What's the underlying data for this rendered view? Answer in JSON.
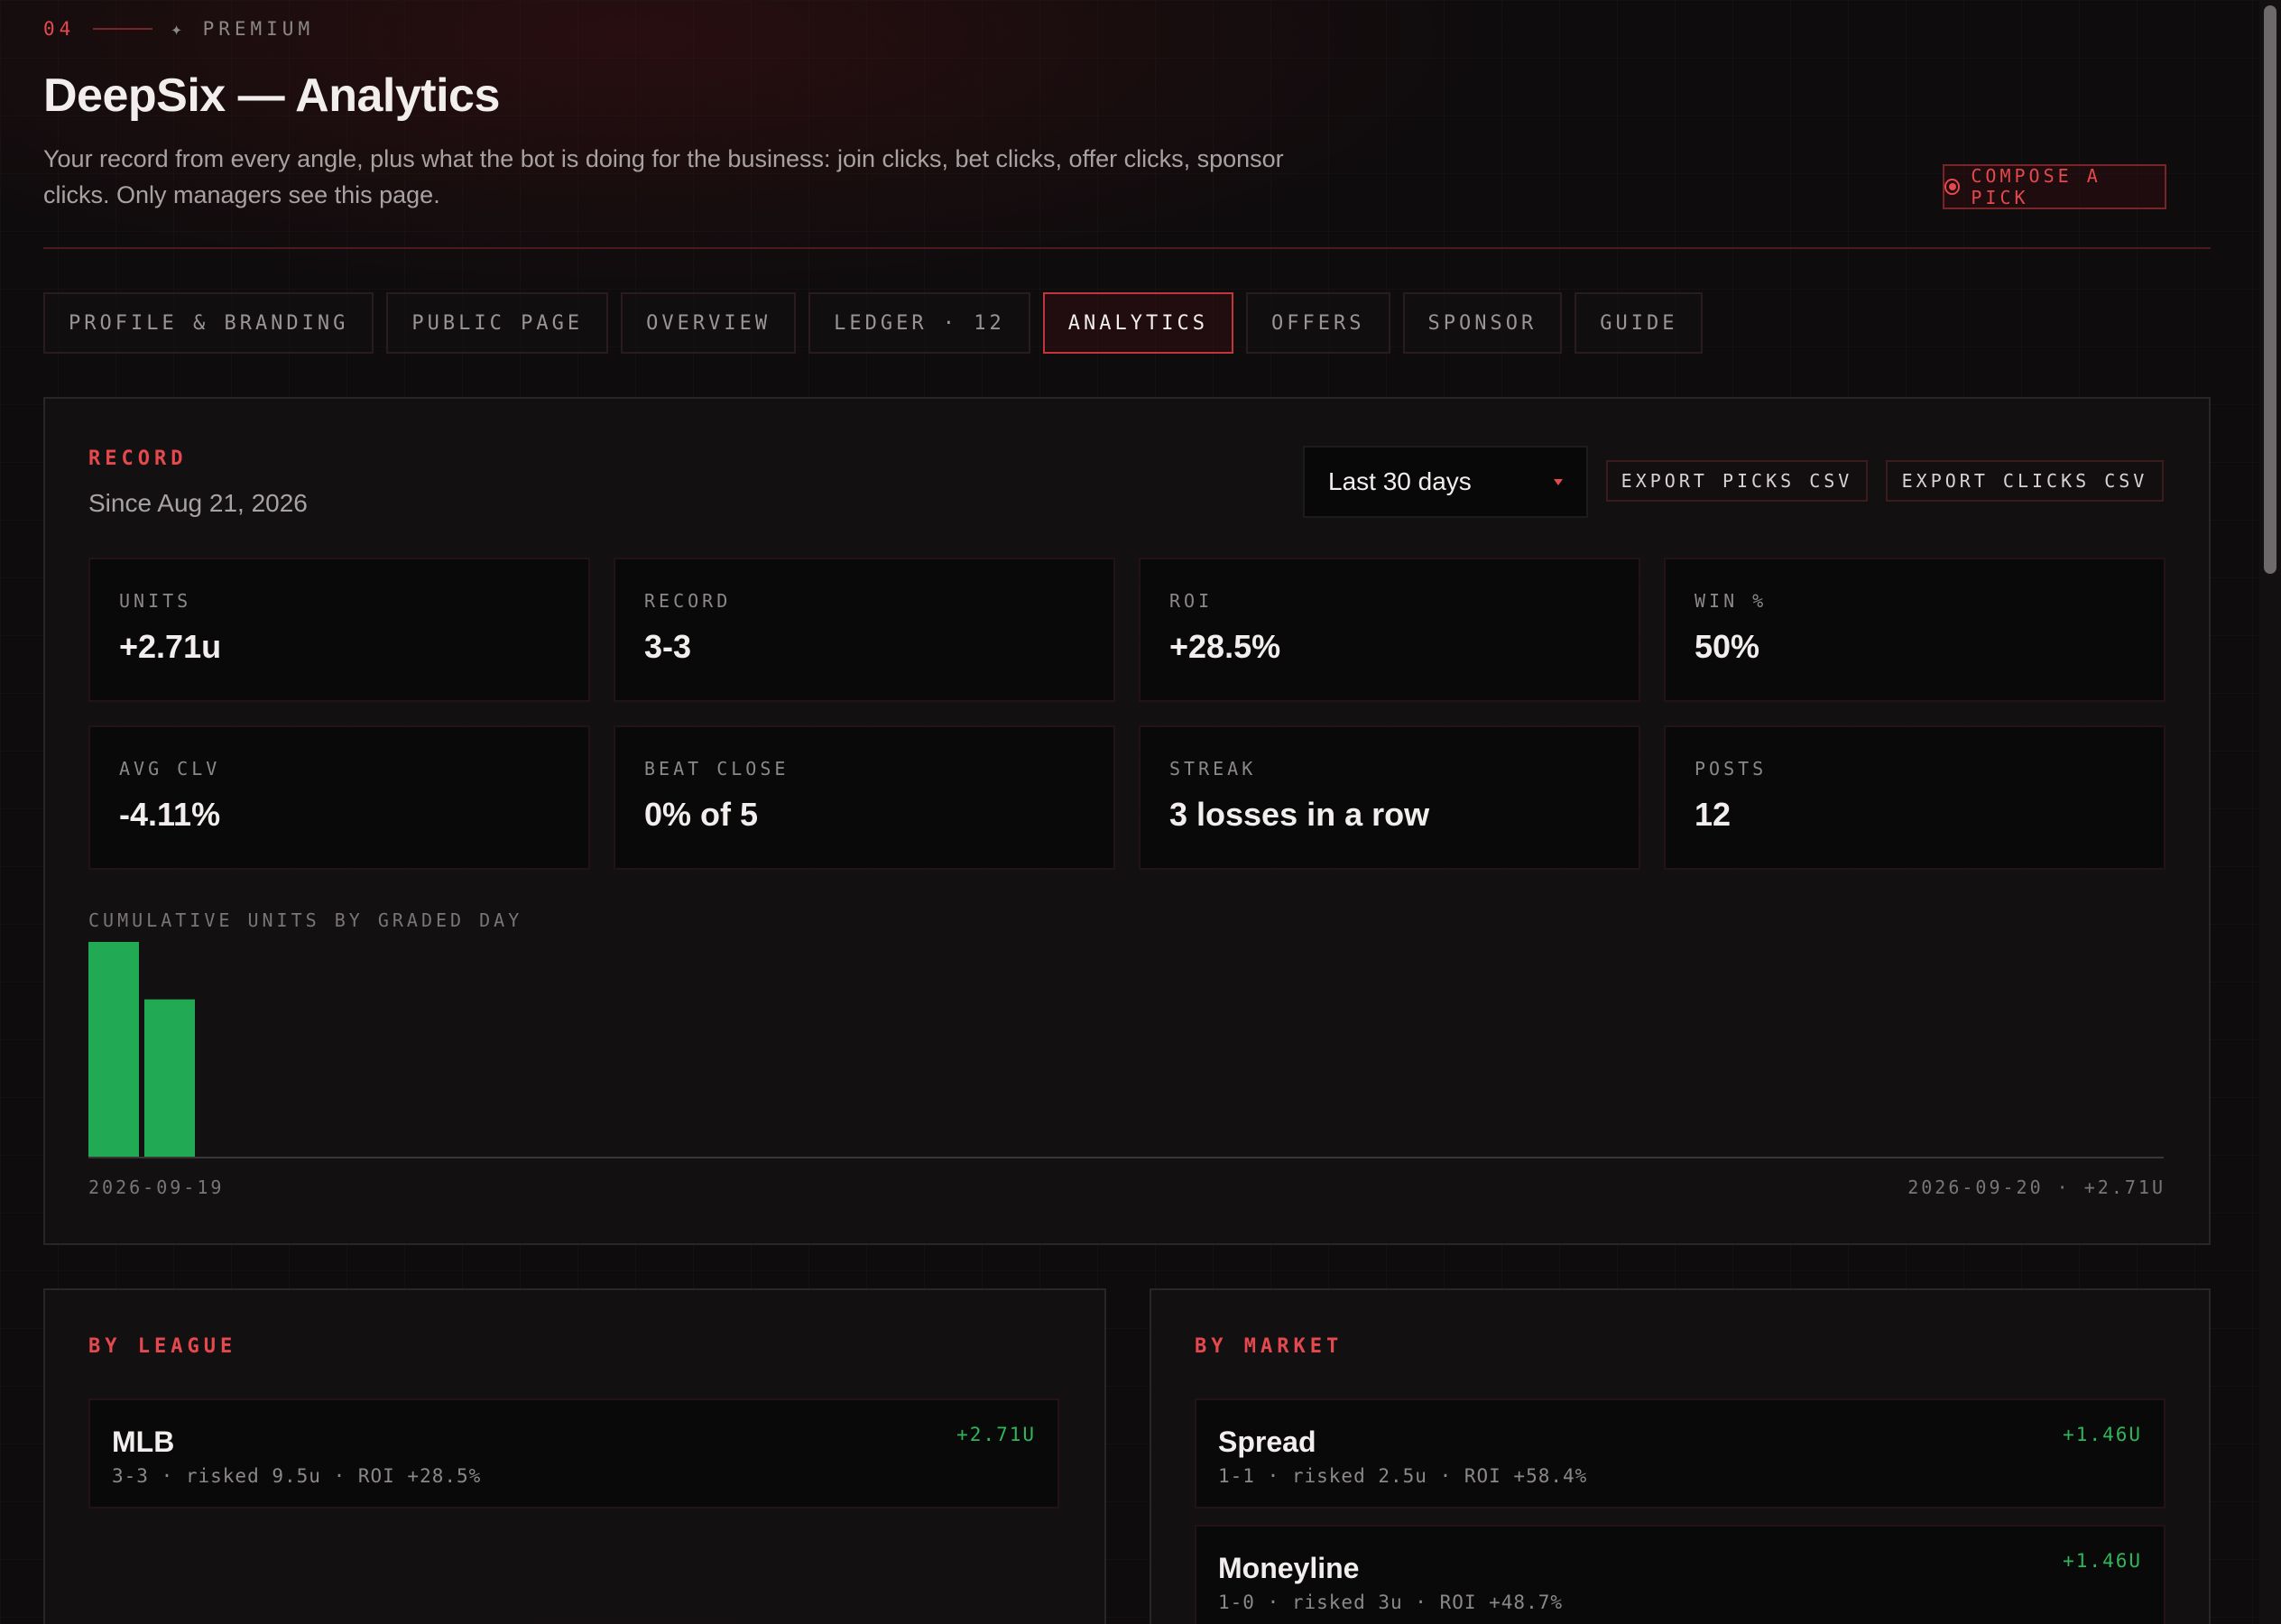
{
  "header": {
    "step": "04",
    "tier": "✦ PREMIUM",
    "title": "DeepSix — Analytics",
    "subtitle": "Your record from every angle, plus what the bot is doing for the business: join clicks, bet clicks, offer clicks, sponsor clicks. Only managers see this page.",
    "compose_label": "COMPOSE A PICK"
  },
  "tabs": [
    {
      "label": "PROFILE & BRANDING"
    },
    {
      "label": "PUBLIC PAGE"
    },
    {
      "label": "OVERVIEW"
    },
    {
      "label": "LEDGER · 12"
    },
    {
      "label": "ANALYTICS"
    },
    {
      "label": "OFFERS"
    },
    {
      "label": "SPONSOR"
    },
    {
      "label": "GUIDE"
    }
  ],
  "record": {
    "label": "RECORD",
    "since": "Since Aug 21, 2026",
    "range": "Last 30 days",
    "export_picks": "EXPORT PICKS CSV",
    "export_clicks": "EXPORT CLICKS CSV",
    "stats": [
      {
        "key": "UNITS",
        "value": "+2.71u"
      },
      {
        "key": "RECORD",
        "value": "3-3"
      },
      {
        "key": "ROI",
        "value": "+28.5%"
      },
      {
        "key": "WIN %",
        "value": "50%"
      },
      {
        "key": "AVG CLV",
        "value": "-4.11%"
      },
      {
        "key": "BEAT CLOSE",
        "value": "0% of 5"
      },
      {
        "key": "STREAK",
        "value": "3 losses in a row"
      },
      {
        "key": "POSTS",
        "value": "12"
      }
    ],
    "chart_label": "CUMULATIVE UNITS BY GRADED DAY",
    "axis_start": "2026-09-19",
    "axis_end": "2026-09-20 · +2.71U"
  },
  "chart_data": {
    "type": "bar",
    "title": "CUMULATIVE UNITS BY GRADED DAY",
    "categories": [
      "2026-09-19",
      "2026-09-20"
    ],
    "values": [
      3.7,
      2.71
    ],
    "ylim": [
      0,
      3.7
    ],
    "xlabel": "",
    "ylabel": "",
    "grid": false,
    "color": "#22a954"
  },
  "by_league": {
    "label": "BY LEAGUE",
    "items": [
      {
        "name": "MLB",
        "meta": "3-3 · risked 9.5u · ROI +28.5%",
        "delta": "+2.71U"
      }
    ]
  },
  "by_market": {
    "label": "BY MARKET",
    "items": [
      {
        "name": "Spread",
        "meta": "1-1 · risked 2.5u · ROI +58.4%",
        "delta": "+1.46U"
      },
      {
        "name": "Moneyline",
        "meta": "1-0 · risked 3u · ROI +48.7%",
        "delta": "+1.46U"
      }
    ]
  },
  "colors": {
    "accent": "#e5484d",
    "positive": "#2fb65a",
    "bar": "#22a954",
    "background": "#0e0c0d"
  }
}
